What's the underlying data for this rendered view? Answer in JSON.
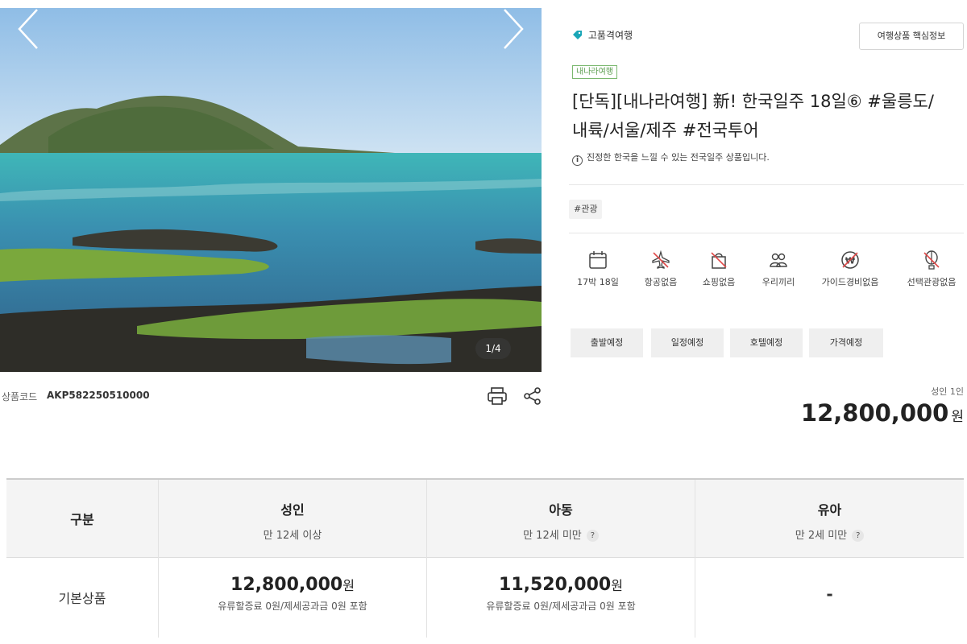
{
  "gallery": {
    "counter": "1/4"
  },
  "product_code": {
    "label": "상품코드",
    "value": "AKP582250510000"
  },
  "category": "고품격여행",
  "info_button": "여행상품 핵심정보",
  "badge": "내나라여행",
  "title": {
    "line1": "[단독][내나라여행] 新! 한국일주 18일⑥ #울릉도/",
    "line2": "내륙/서울/제주 #전국투어"
  },
  "description": "진정한 한국을 느낄 수 있는 전국일주 상품입니다.",
  "hashtag": "#관광",
  "features": [
    {
      "icon": "calendar-icon",
      "label": "17박 18일"
    },
    {
      "icon": "no-airplane-icon",
      "label": "항공없음"
    },
    {
      "icon": "no-shopping-icon",
      "label": "쇼핑없음"
    },
    {
      "icon": "group-icon",
      "label": "우리끼리"
    },
    {
      "icon": "no-guide-fee-icon",
      "label": "가이드경비없음"
    },
    {
      "icon": "no-optional-tour-icon",
      "label": "선택관광없음"
    }
  ],
  "schedule_buttons": [
    "출발예정",
    "일정예정",
    "호텔예정",
    "가격예정"
  ],
  "price_box": {
    "per": "성인 1인",
    "amount": "12,800,000",
    "unit": "원"
  },
  "price_table": {
    "header": {
      "label": "구분",
      "columns": [
        {
          "title": "성인",
          "sub": "만 12세 이상",
          "help": ""
        },
        {
          "title": "아동",
          "sub": "만 12세 미만",
          "help": "?"
        },
        {
          "title": "유아",
          "sub": "만 2세 미만",
          "help": "?"
        }
      ]
    },
    "row": {
      "label": "기본상품",
      "cells": [
        {
          "amount": "12,800,000",
          "unit": "원",
          "note": "유류할증료 0원/제세공과금 0원 포함"
        },
        {
          "amount": "11,520,000",
          "unit": "원",
          "note": "유류할증료 0원/제세공과금 0원 포함"
        },
        {
          "dash": "-"
        }
      ]
    }
  },
  "colors": {
    "badge_green": "#5b9d4f",
    "tag_teal": "#1aa6b7",
    "strike_red": "#e04848"
  }
}
